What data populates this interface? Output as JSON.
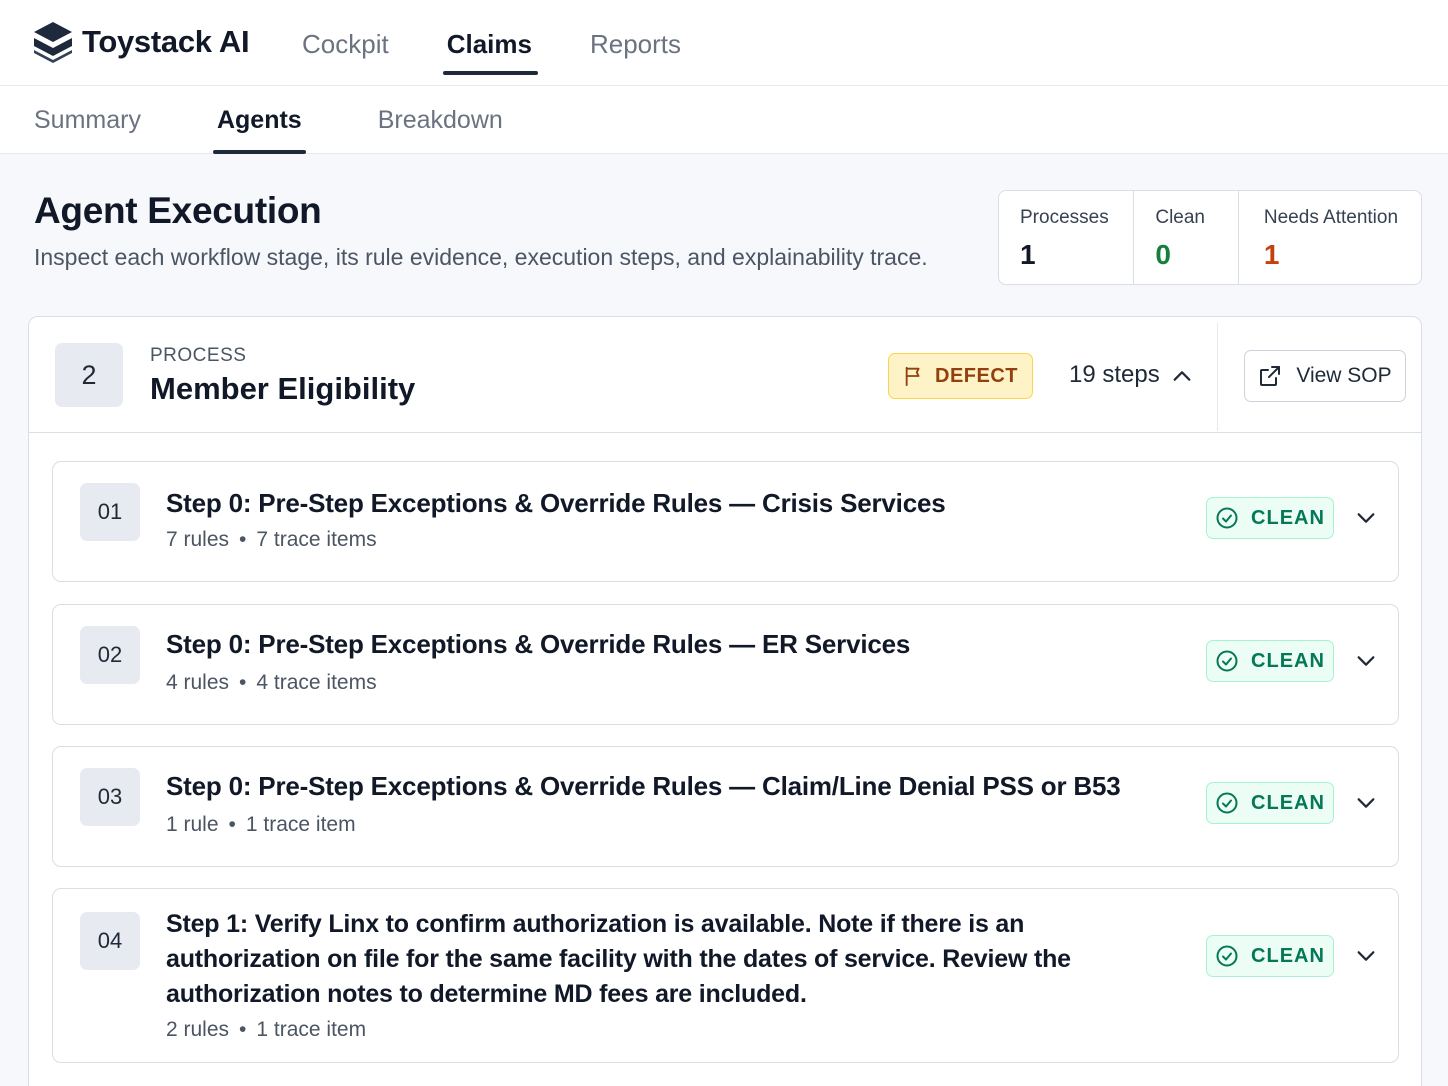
{
  "app": {
    "name": "Toystack AI"
  },
  "top_nav": [
    {
      "label": "Cockpit",
      "active": false
    },
    {
      "label": "Claims",
      "active": true
    },
    {
      "label": "Reports",
      "active": false
    }
  ],
  "sub_nav": [
    {
      "label": "Summary",
      "active": false
    },
    {
      "label": "Agents",
      "active": true
    },
    {
      "label": "Breakdown",
      "active": false
    }
  ],
  "page": {
    "title": "Agent Execution",
    "subtitle": "Inspect each workflow stage, its rule evidence, execution steps, and explainability trace."
  },
  "stats": [
    {
      "label": "Processes",
      "value": "1",
      "color": "#111827"
    },
    {
      "label": "Clean",
      "value": "0",
      "color": "#15803d"
    },
    {
      "label": "Needs Attention",
      "value": "1",
      "color": "#c2410c"
    }
  ],
  "process": {
    "number": "2",
    "kicker": "PROCESS",
    "title": "Member Eligibility",
    "badge": "DEFECT",
    "steps_count": "19 steps",
    "view_sop_label": "View SOP",
    "steps": [
      {
        "num": "01",
        "title": "Step 0: Pre-Step Exceptions & Override Rules — Crisis Services",
        "rules": "7 rules",
        "trace": "7 trace items",
        "status": "CLEAN"
      },
      {
        "num": "02",
        "title": "Step 0: Pre-Step Exceptions & Override Rules — ER Services",
        "rules": "4 rules",
        "trace": "4 trace items",
        "status": "CLEAN"
      },
      {
        "num": "03",
        "title": "Step 0: Pre-Step Exceptions & Override Rules — Claim/Line Denial PSS or B53",
        "rules": "1 rule",
        "trace": "1 trace item",
        "status": "CLEAN"
      },
      {
        "num": "04",
        "title": "Step 1: Verify Linx to confirm authorization is available. Note if there is an authorization on file for the same facility with the dates of service. Review the authorization notes to determine MD fees are included.",
        "rules": "2 rules",
        "trace": "1 trace item",
        "status": "CLEAN"
      }
    ]
  },
  "colors": {
    "accent": "#1e293b",
    "clean": "#047857",
    "defect": "#92400e"
  }
}
